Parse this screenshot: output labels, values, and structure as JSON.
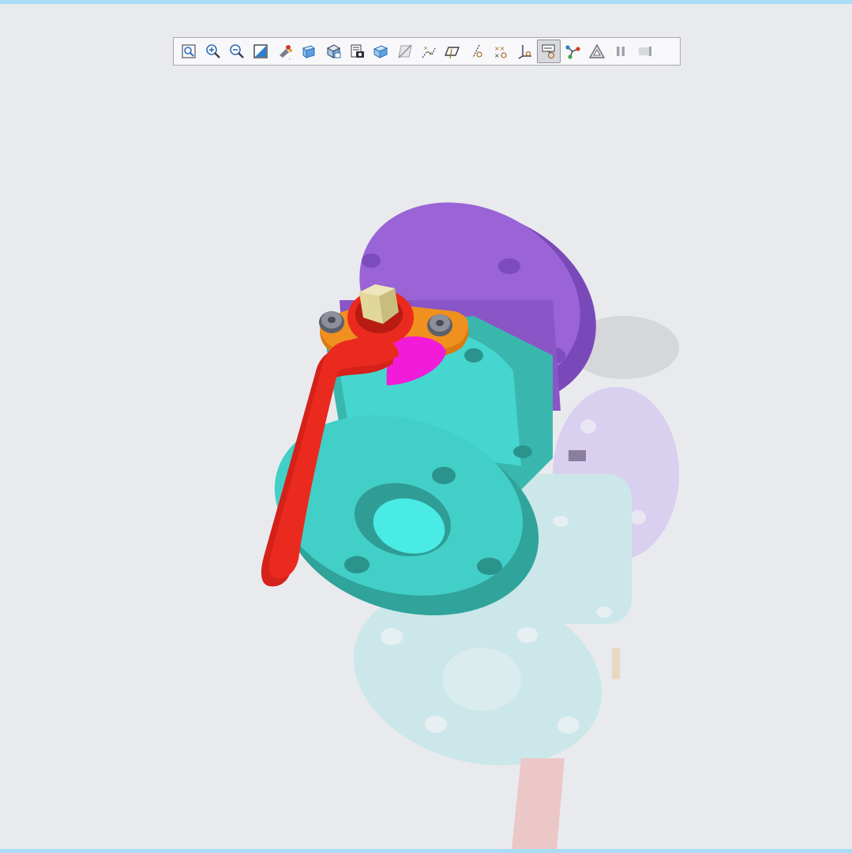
{
  "toolbar": {
    "buttons": [
      {
        "icon": "refit-icon"
      },
      {
        "icon": "zoom-in-icon"
      },
      {
        "icon": "zoom-out-icon"
      },
      {
        "icon": "repaint-icon"
      },
      {
        "icon": "spin-center-icon"
      },
      {
        "icon": "saved-orientations-icon"
      },
      {
        "icon": "view-manager-icon"
      },
      {
        "icon": "display-style-icon"
      },
      {
        "icon": "perspective-icon"
      },
      {
        "icon": "datum-display-icon"
      },
      {
        "icon": "plane-display-icon"
      },
      {
        "icon": "axis-display-icon"
      },
      {
        "icon": "point-display-icon"
      },
      {
        "icon": "csys-display-icon"
      },
      {
        "icon": "annotation-display-icon",
        "active": true
      },
      {
        "icon": "explode-view-icon"
      },
      {
        "icon": "section-icon"
      },
      {
        "icon": "pause-icon"
      },
      {
        "icon": "next-icon"
      }
    ]
  },
  "colors": {
    "background": "#e9eaee",
    "frame": "#a9dcf5",
    "body": "#45d6cf",
    "flange_end": "#9a63d6",
    "handle": "#ea2a1f",
    "gland": "#f0901f",
    "stem": "#e2d79a",
    "stop": "#f21bd9",
    "bolt": "#7b7f8b"
  }
}
